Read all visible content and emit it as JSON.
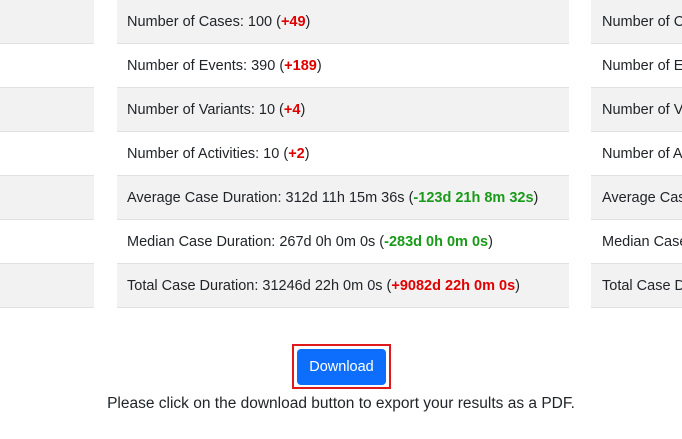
{
  "left_column": {
    "rows": [
      "",
      "",
      "",
      "",
      "",
      "",
      ""
    ]
  },
  "middle_column": {
    "rows": [
      {
        "label": "Number of Cases: 100",
        "delta": "+49",
        "delta_color": "#e00000"
      },
      {
        "label": "Number of Events: 390",
        "delta": "+189",
        "delta_color": "#e00000"
      },
      {
        "label": "Number of Variants: 10",
        "delta": "+4",
        "delta_color": "#e00000"
      },
      {
        "label": "Number of Activities: 10",
        "delta": "+2",
        "delta_color": "#e00000"
      },
      {
        "label": "Average Case Duration: 312d 11h 15m 36s",
        "delta": "-123d 21h 8m 32s",
        "delta_color": "#1a9a1a"
      },
      {
        "label": "Median Case Duration: 267d 0h 0m 0s",
        "delta": "-283d 0h 0m 0s",
        "delta_color": "#1a9a1a"
      },
      {
        "label": "Total Case Duration: 31246d 22h 0m 0s",
        "delta": "+9082d 22h 0m 0s",
        "delta_color": "#e00000"
      }
    ]
  },
  "right_column": {
    "rows": [
      "Number of C",
      "Number of E",
      "Number of V",
      "Number of A",
      "Average Cas",
      "Median Case",
      "Total Case D"
    ]
  },
  "download": {
    "label": "Download",
    "button_color": "#0d6efd",
    "highlight_color": "#e01a1a"
  },
  "instructions": "Please click on the download button to export your results as a PDF."
}
